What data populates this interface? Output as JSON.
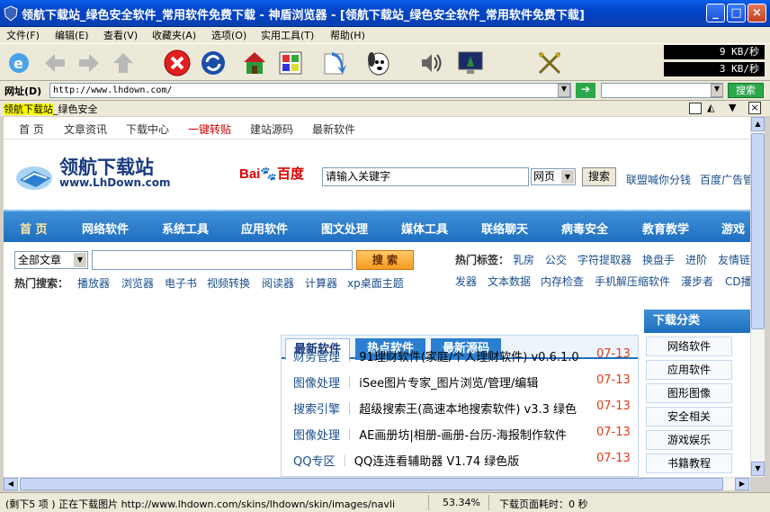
{
  "window": {
    "title": "领航下载站_绿色安全软件_常用软件免费下载 - 神盾浏览器 - [领航下载站_绿色安全软件_常用软件免费下载]",
    "min": "_",
    "max": "□",
    "close": "×"
  },
  "menu": [
    "文件(F)",
    "编辑(E)",
    "查看(V)",
    "收藏夹(A)",
    "选项(O)",
    "实用工具(T)",
    "帮助(H)"
  ],
  "speeds": [
    "9 KB/秒",
    "3 KB/秒"
  ],
  "address": {
    "label": "网址(D)",
    "url": "http://www.lhdown.com/",
    "search_label": "搜索"
  },
  "tab": {
    "highlight": "领航下载站",
    "rest": "_绿色安全"
  },
  "page": {
    "toplinks": [
      "首 页",
      "文章资讯",
      "下载中心",
      "一键转贴",
      "建站源码",
      "最新软件"
    ],
    "logo": {
      "cn": "领航下载站",
      "url": "www.LhDown.com"
    },
    "baidu": "百度",
    "search_value": "请输入关键字",
    "search_scope": "网页",
    "search_btn": "搜索",
    "union_links": [
      "联盟喊你分钱",
      "百度广告管"
    ],
    "nav": [
      "首 页",
      "网络软件",
      "系统工具",
      "应用软件",
      "图文处理",
      "媒体工具",
      "联络聊天",
      "病毒安全",
      "教育教学",
      "游戏"
    ],
    "article_select": "全部文章",
    "search2_btn": "搜 索",
    "hot_search_label": "热门搜索：",
    "hot_search": [
      "播放器",
      "浏览器",
      "电子书",
      "视频转换",
      "阅读器",
      "计算器",
      "xp桌面主题"
    ],
    "hot_tags_label": "热门标签：",
    "hot_tags1": [
      "乳房",
      "公交",
      "字符提取器",
      "换盘手",
      "进阶",
      "友情链"
    ],
    "hot_tags2": [
      "发器",
      "文本数据",
      "内存检查",
      "手机解压缩软件",
      "漫步者",
      "CD播"
    ],
    "tabs": [
      "最新软件",
      "热点软件",
      "最新源码"
    ],
    "rows": [
      {
        "cat": "财务管理",
        "name": "91理财软件(家庭/个人理财软件) v0.6.1.0",
        "date": "07-13"
      },
      {
        "cat": "图像处理",
        "name": "iSee图片专家_图片浏览/管理/编辑",
        "date": "07-13"
      },
      {
        "cat": "搜索引擎",
        "name": "超级搜索王(高速本地搜索软件) v3.3 绿色",
        "date": "07-13"
      },
      {
        "cat": "图像处理",
        "name": "AE画册坊|相册-画册-台历-海报制作软件",
        "date": "07-13"
      },
      {
        "cat": "QQ专区",
        "name": "QQ连连看辅助器 V1.74 绿色版",
        "date": "07-13"
      }
    ],
    "side_title": "下载分类",
    "side_items": [
      "网络软件",
      "应用软件",
      "图形图像",
      "安全相关",
      "游戏娱乐",
      "书籍教程"
    ]
  },
  "status": {
    "left": "(剩下5 项 ) 正在下载图片 http://www.lhdown.com/skins/lhdown/skin/images/navli",
    "percent": "53.34%",
    "time": "下载页面耗时：0 秒"
  }
}
